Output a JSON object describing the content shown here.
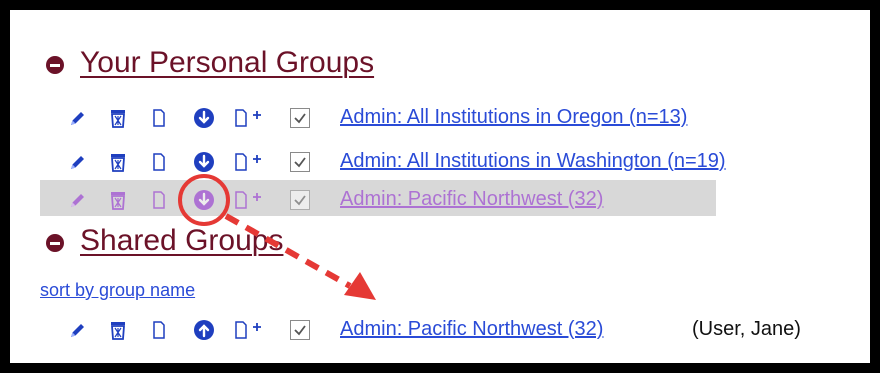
{
  "personal_groups": {
    "heading": "Your Personal Groups",
    "items": [
      {
        "label": "Admin: All Institutions in Oregon (n=13)",
        "checked": true
      },
      {
        "label": "Admin: All Institutions in Washington (n=19)",
        "checked": true
      },
      {
        "label": "Admin: Pacific Northwest (32)",
        "checked": true,
        "highlighted": true
      }
    ]
  },
  "shared_groups": {
    "heading": "Shared Groups",
    "sort_link": "sort by group name",
    "items": [
      {
        "label": "Admin: Pacific Northwest (32)",
        "owner": "(User, Jane)",
        "checked": true
      }
    ]
  },
  "icons": [
    "pencil-icon",
    "trash-icon",
    "copy-icon",
    "move-down-icon",
    "move-up-icon",
    "copy-plus-icon"
  ],
  "colors": {
    "heading": "#6b1228",
    "link": "#2a4bd7",
    "icon_primary": "#1f3fbf",
    "annotation_red": "#e53935",
    "highlight_row": "#d8d8d8"
  }
}
